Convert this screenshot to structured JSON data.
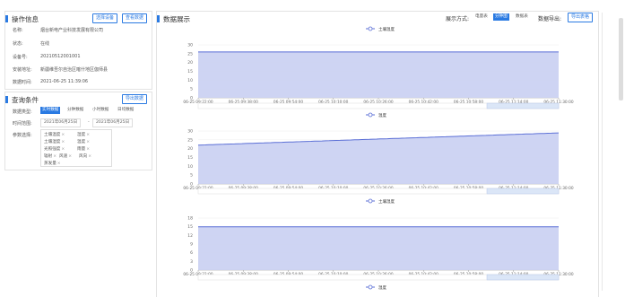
{
  "op_panel": {
    "title": "操作信息",
    "btn_select": "选择设备",
    "btn_view": "查看数据",
    "rows": [
      {
        "label": "名称:",
        "value": "烟台新电产业科技发展有限公司"
      },
      {
        "label": "状态:",
        "value": "在线"
      },
      {
        "label": "设备号:",
        "value": "20210512001001"
      },
      {
        "label": "安装地址:",
        "value": "新疆维吾尔自治区喀什地区伽师县"
      },
      {
        "label": "数据时间:",
        "value": "2021-06-25 11:39:06"
      }
    ]
  },
  "query_panel": {
    "title": "查询条件",
    "btn_export": "导出数据",
    "type_label": "数据类型:",
    "types": [
      "实时数据",
      "分钟数据",
      "小时数据",
      "日均数据"
    ],
    "active_type": 0,
    "time_label": "时间范围:",
    "date_start": "2021年06月25日",
    "date_sep": "-",
    "date_end": "2021年06月25日",
    "param_label": "参数选择:",
    "params": [
      "土壤温度",
      "湿度",
      "土壤湿度",
      "温度",
      "光照强度",
      "雨量",
      "辐射",
      "风速",
      "风向",
      "蒸发量"
    ]
  },
  "display_panel": {
    "title": "数据展示",
    "mode_label": "展示方式:",
    "modes": [
      "电量表",
      "分钟图",
      "数据表"
    ],
    "active_mode": 1,
    "export_label": "数据导出:",
    "btn_export": "导出表格"
  },
  "chart_data": [
    {
      "type": "area",
      "title": "",
      "series": [
        {
          "name": "土壤温度",
          "values": [
            26,
            26,
            26,
            26,
            26,
            26,
            26,
            26,
            26,
            26,
            26,
            26,
            26,
            26,
            26,
            26,
            26,
            26,
            26,
            26,
            26,
            26,
            26,
            26,
            26,
            26,
            26,
            26,
            26,
            26,
            26,
            26,
            26,
            26,
            26,
            26,
            26,
            26,
            26,
            26,
            26,
            26,
            26,
            26,
            26,
            26,
            26,
            26,
            26,
            26,
            26,
            26,
            26,
            26,
            26,
            26,
            26,
            26,
            26,
            26,
            26,
            26,
            26,
            26,
            26,
            26,
            26,
            26,
            26,
            26,
            26,
            26,
            26,
            26,
            26,
            26,
            26,
            26,
            26,
            26,
            26,
            26,
            26,
            26,
            26,
            26,
            26,
            26,
            26,
            26,
            26,
            26,
            26,
            26,
            26,
            26,
            26,
            26,
            26,
            26
          ]
        }
      ],
      "ylim": [
        0,
        30
      ],
      "yticks": [
        0,
        5,
        10,
        15,
        20,
        25,
        30
      ],
      "xticks": [
        "06-25 09:22:00",
        "06-25 09:38:00",
        "06-25 09:54:00",
        "06-25 10:10:00",
        "06-25 10:26:00",
        "06-25 10:42:00",
        "06-25 10:58:00",
        "06-25 11:14:00",
        "06-25 11:30:00"
      ]
    },
    {
      "type": "area",
      "title": "",
      "series": [
        {
          "name": "温度",
          "values": [
            22.0,
            22.07,
            22.14,
            22.21,
            22.28,
            22.35,
            22.42,
            22.49,
            22.56,
            22.63,
            22.7,
            22.77,
            22.84,
            22.91,
            22.98,
            23.05,
            23.12,
            23.19,
            23.26,
            23.33,
            23.4,
            23.47,
            23.54,
            23.61,
            23.68,
            23.75,
            23.82,
            23.89,
            23.96,
            24.03,
            24.1,
            24.17,
            24.24,
            24.31,
            24.38,
            24.45,
            24.52,
            24.59,
            24.66,
            24.73,
            24.8,
            24.87,
            24.94,
            25.01,
            25.08,
            25.15,
            25.22,
            25.29,
            25.36,
            25.43,
            25.5,
            25.57,
            25.64,
            25.71,
            25.78,
            25.85,
            25.92,
            25.99,
            26.06,
            26.13,
            26.2,
            26.27,
            26.34,
            26.41,
            26.48,
            26.55,
            26.62,
            26.69,
            26.76,
            26.83,
            26.9,
            26.97,
            27.04,
            27.11,
            27.18,
            27.25,
            27.32,
            27.39,
            27.46,
            27.53,
            27.6,
            27.67,
            27.74,
            27.81,
            27.88,
            27.95,
            28.02,
            28.09,
            28.16,
            28.23,
            28.3,
            28.37,
            28.44,
            28.51,
            28.58,
            28.65,
            28.72,
            28.79,
            28.86,
            28.93
          ]
        }
      ],
      "ylim": [
        0,
        30
      ],
      "yticks": [
        0,
        5,
        10,
        15,
        20,
        25,
        30
      ],
      "xticks": [
        "06-25 09:22:00",
        "06-25 09:38:00",
        "06-25 09:54:00",
        "06-25 10:10:00",
        "06-25 10:26:00",
        "06-25 10:42:00",
        "06-25 10:58:00",
        "06-25 11:14:00",
        "06-25 11:30:00"
      ]
    },
    {
      "type": "area",
      "title": "",
      "series": [
        {
          "name": "土壤湿度",
          "values": [
            15,
            15,
            15,
            15,
            15,
            15,
            15,
            15,
            15,
            15,
            15,
            15,
            15,
            15,
            15,
            15,
            15,
            15,
            15,
            15,
            15,
            15,
            15,
            15,
            15,
            15,
            15,
            15,
            15,
            15,
            15,
            15,
            15,
            15,
            15,
            15,
            15,
            15,
            15,
            15,
            15,
            15,
            15,
            15,
            15,
            15,
            15,
            15,
            15,
            15,
            15,
            15,
            15,
            15,
            15,
            15,
            15,
            15,
            15,
            15,
            15,
            15,
            15,
            15,
            15,
            15,
            15,
            15,
            15,
            15,
            15,
            15,
            15,
            15,
            15,
            15,
            15,
            15,
            15,
            15,
            15,
            15,
            15,
            15,
            15,
            15,
            15,
            15,
            15,
            15,
            15,
            15,
            15,
            15,
            15,
            15,
            15,
            15,
            15,
            15
          ]
        }
      ],
      "ylim": [
        0,
        18
      ],
      "yticks": [
        0,
        3,
        6,
        9,
        12,
        15,
        18
      ],
      "xticks": [
        "06-25 09:22:00",
        "06-25 09:38:00",
        "06-25 09:54:00",
        "06-25 10:10:00",
        "06-25 10:26:00",
        "06-25 10:42:00",
        "06-25 10:58:00",
        "06-25 11:14:00",
        "06-25 11:30:00"
      ]
    },
    {
      "type": "area",
      "title": "",
      "series": [
        {
          "name": "湿度",
          "values": []
        }
      ],
      "ylim": [
        0,
        30
      ],
      "yticks": [],
      "xticks": []
    }
  ],
  "colors": {
    "accent": "#2a7ae2",
    "series": "#5b6fd6",
    "fill": "#c9cff2"
  }
}
